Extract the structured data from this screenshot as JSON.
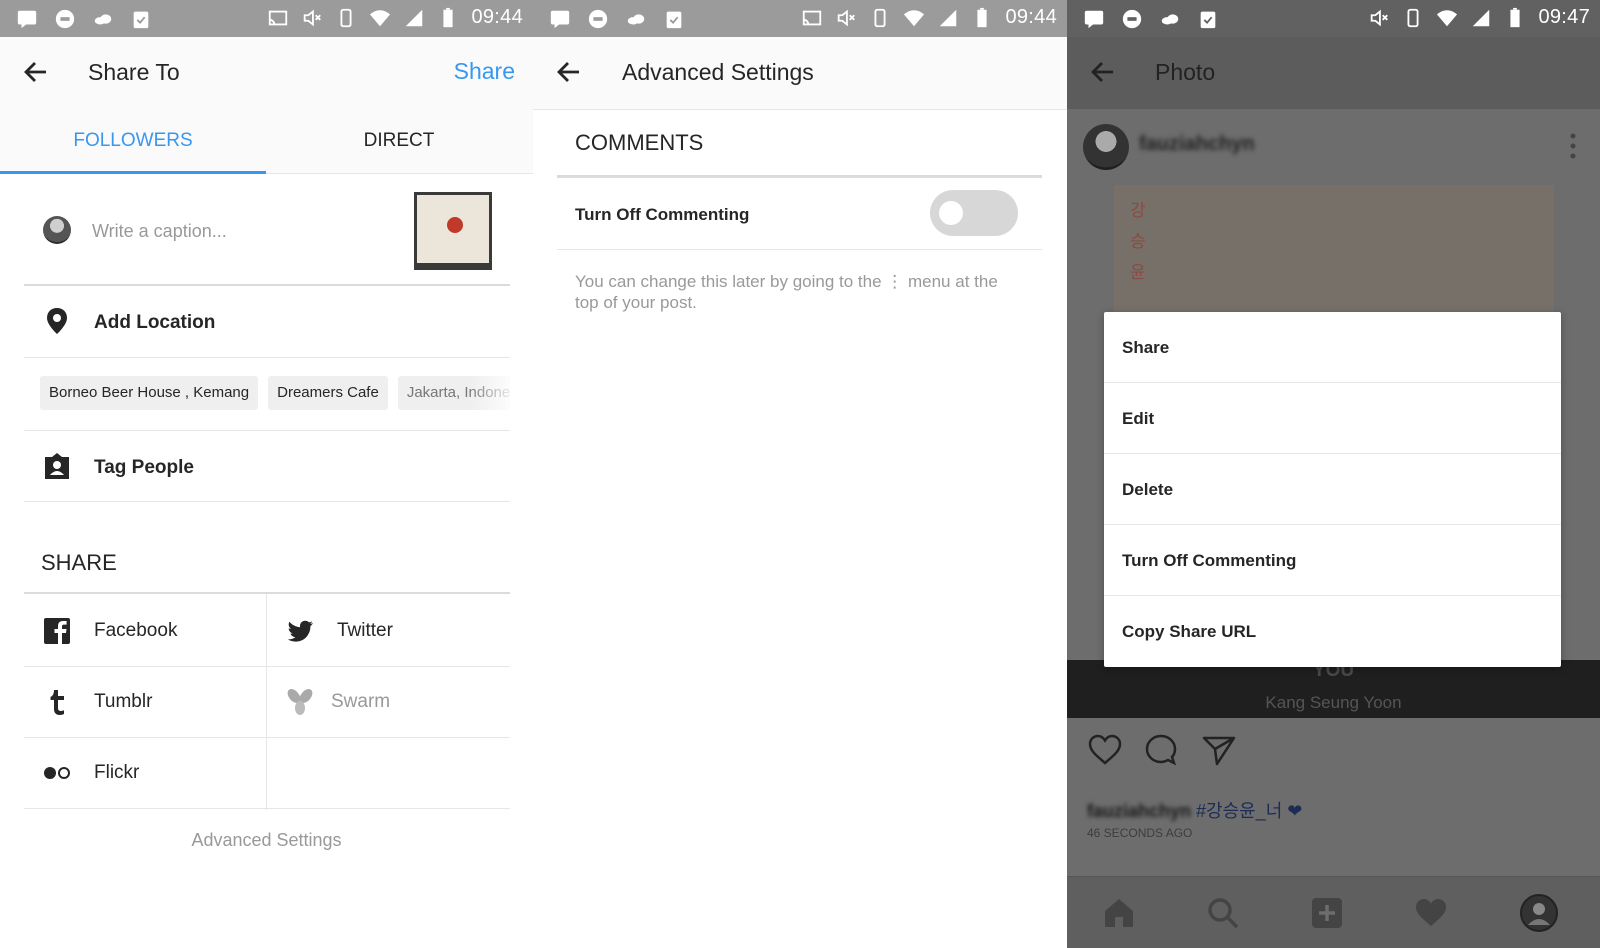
{
  "panel1": {
    "status_time": "09:44",
    "header": {
      "title": "Share To",
      "action": "Share"
    },
    "tabs": [
      {
        "label": "FOLLOWERS",
        "active": true
      },
      {
        "label": "DIRECT",
        "active": false
      }
    ],
    "caption_placeholder": "Write a caption...",
    "add_location": "Add Location",
    "location_chips": [
      "Borneo Beer House , Kemang",
      "Dreamers Cafe",
      "Jakarta, Indonesia"
    ],
    "tag_people": "Tag People",
    "share_heading": "SHARE",
    "share_targets": [
      {
        "label": "Facebook",
        "icon": "facebook-icon",
        "enabled": true
      },
      {
        "label": "Twitter",
        "icon": "twitter-icon",
        "enabled": true
      },
      {
        "label": "Tumblr",
        "icon": "tumblr-icon",
        "enabled": true
      },
      {
        "label": "Swarm",
        "icon": "swarm-icon",
        "enabled": false
      },
      {
        "label": "Flickr",
        "icon": "flickr-icon",
        "enabled": true
      }
    ],
    "advanced_settings": "Advanced Settings"
  },
  "panel2": {
    "status_time": "09:44",
    "header": {
      "title": "Advanced Settings"
    },
    "section_title": "COMMENTS",
    "toggle_label": "Turn Off Commenting",
    "toggle_on": false,
    "help_text": "You can change this later by going to the ⋮ menu at the top of your post."
  },
  "panel3": {
    "status_time": "09:47",
    "header": {
      "title": "Photo"
    },
    "username": "fauziahchyn",
    "photo_korean_text": "강 승 윤",
    "album_title": "YOU",
    "album_artist": "Kang Seung Yoon",
    "caption_hashtag": "#강승윤_너 ❤",
    "timestamp": "46 SECONDS AGO",
    "menu": [
      "Share",
      "Edit",
      "Delete",
      "Turn Off Commenting",
      "Copy Share URL"
    ]
  },
  "colors": {
    "accent": "#3897f0",
    "statusbar": "#9b9b9b",
    "overlay": "#6d6d6d"
  }
}
